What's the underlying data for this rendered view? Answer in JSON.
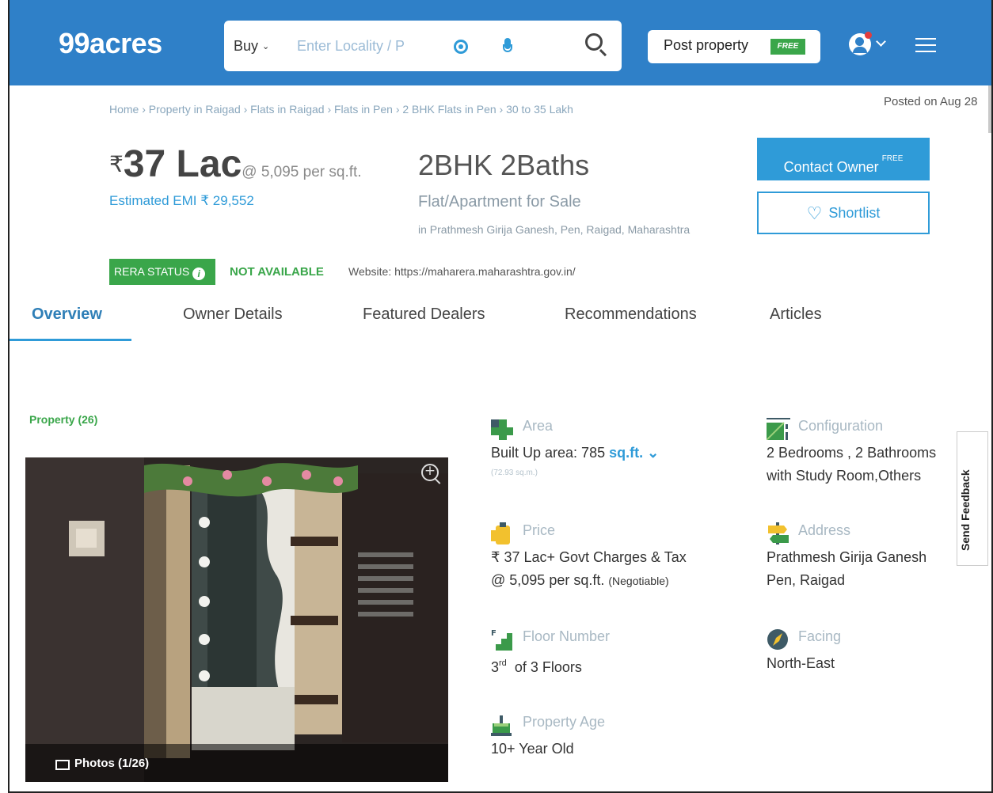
{
  "header": {
    "logo": "99acres",
    "search": {
      "mode": "Buy",
      "placeholder": "Enter Locality / P"
    },
    "post_property": {
      "label": "Post property",
      "tag": "FREE"
    }
  },
  "breadcrumb": "Home › Property in Raigad › Flats in Raigad › Flats in Pen › 2 BHK Flats in Pen › 30 to 35 Lakh",
  "posted": "Posted on Aug 28",
  "price": {
    "currency": "₹",
    "amount": "37 Lac",
    "per_sqft": "@ 5,095 per sq.ft.",
    "emi": "Estimated EMI ₹ 29,552"
  },
  "listing": {
    "config": "2BHK 2Baths",
    "type": "Flat/Apartment for Sale",
    "location": "in Prathmesh Girija Ganesh, Pen, Raigad, Maharashtra"
  },
  "actions": {
    "contact": "Contact Owner",
    "contact_tag": "FREE",
    "shortlist": "Shortlist"
  },
  "rera": {
    "badge": "RERA STATUS",
    "status": "NOT AVAILABLE",
    "website": "Website: https://maharera.maharashtra.gov.in/"
  },
  "tabs": [
    "Overview",
    "Owner Details",
    "Featured Dealers",
    "Recommendations",
    "Articles"
  ],
  "photos": {
    "section": "Property (26)",
    "label": "Photos (1/26)"
  },
  "details": {
    "area": {
      "label": "Area",
      "value": "Built Up area: 785",
      "unit": "sq.ft.",
      "sqm": "(72.93 sq.m.)"
    },
    "configuration": {
      "label": "Configuration",
      "line1": "2 Bedrooms , 2 Bathrooms",
      "line2": "with Study Room,Others"
    },
    "price": {
      "label": "Price",
      "line1": "₹ 37 Lac+ Govt Charges & Tax",
      "line2": "@ 5,095 per sq.ft.",
      "note": "(Negotiable)"
    },
    "address": {
      "label": "Address",
      "line1": "Prathmesh Girija Ganesh",
      "line2": "Pen, Raigad"
    },
    "floor": {
      "label": "Floor Number",
      "value": "3",
      "suffix": "rd",
      "rest": "of 3 Floors"
    },
    "facing": {
      "label": "Facing",
      "value": "North-East"
    },
    "age": {
      "label": "Property Age",
      "value": "10+ Year Old"
    }
  },
  "feedback": "Send Feedback",
  "colors": {
    "brand": "#2f80c8",
    "accent": "#2f9bd8",
    "green": "#3aa64a"
  }
}
